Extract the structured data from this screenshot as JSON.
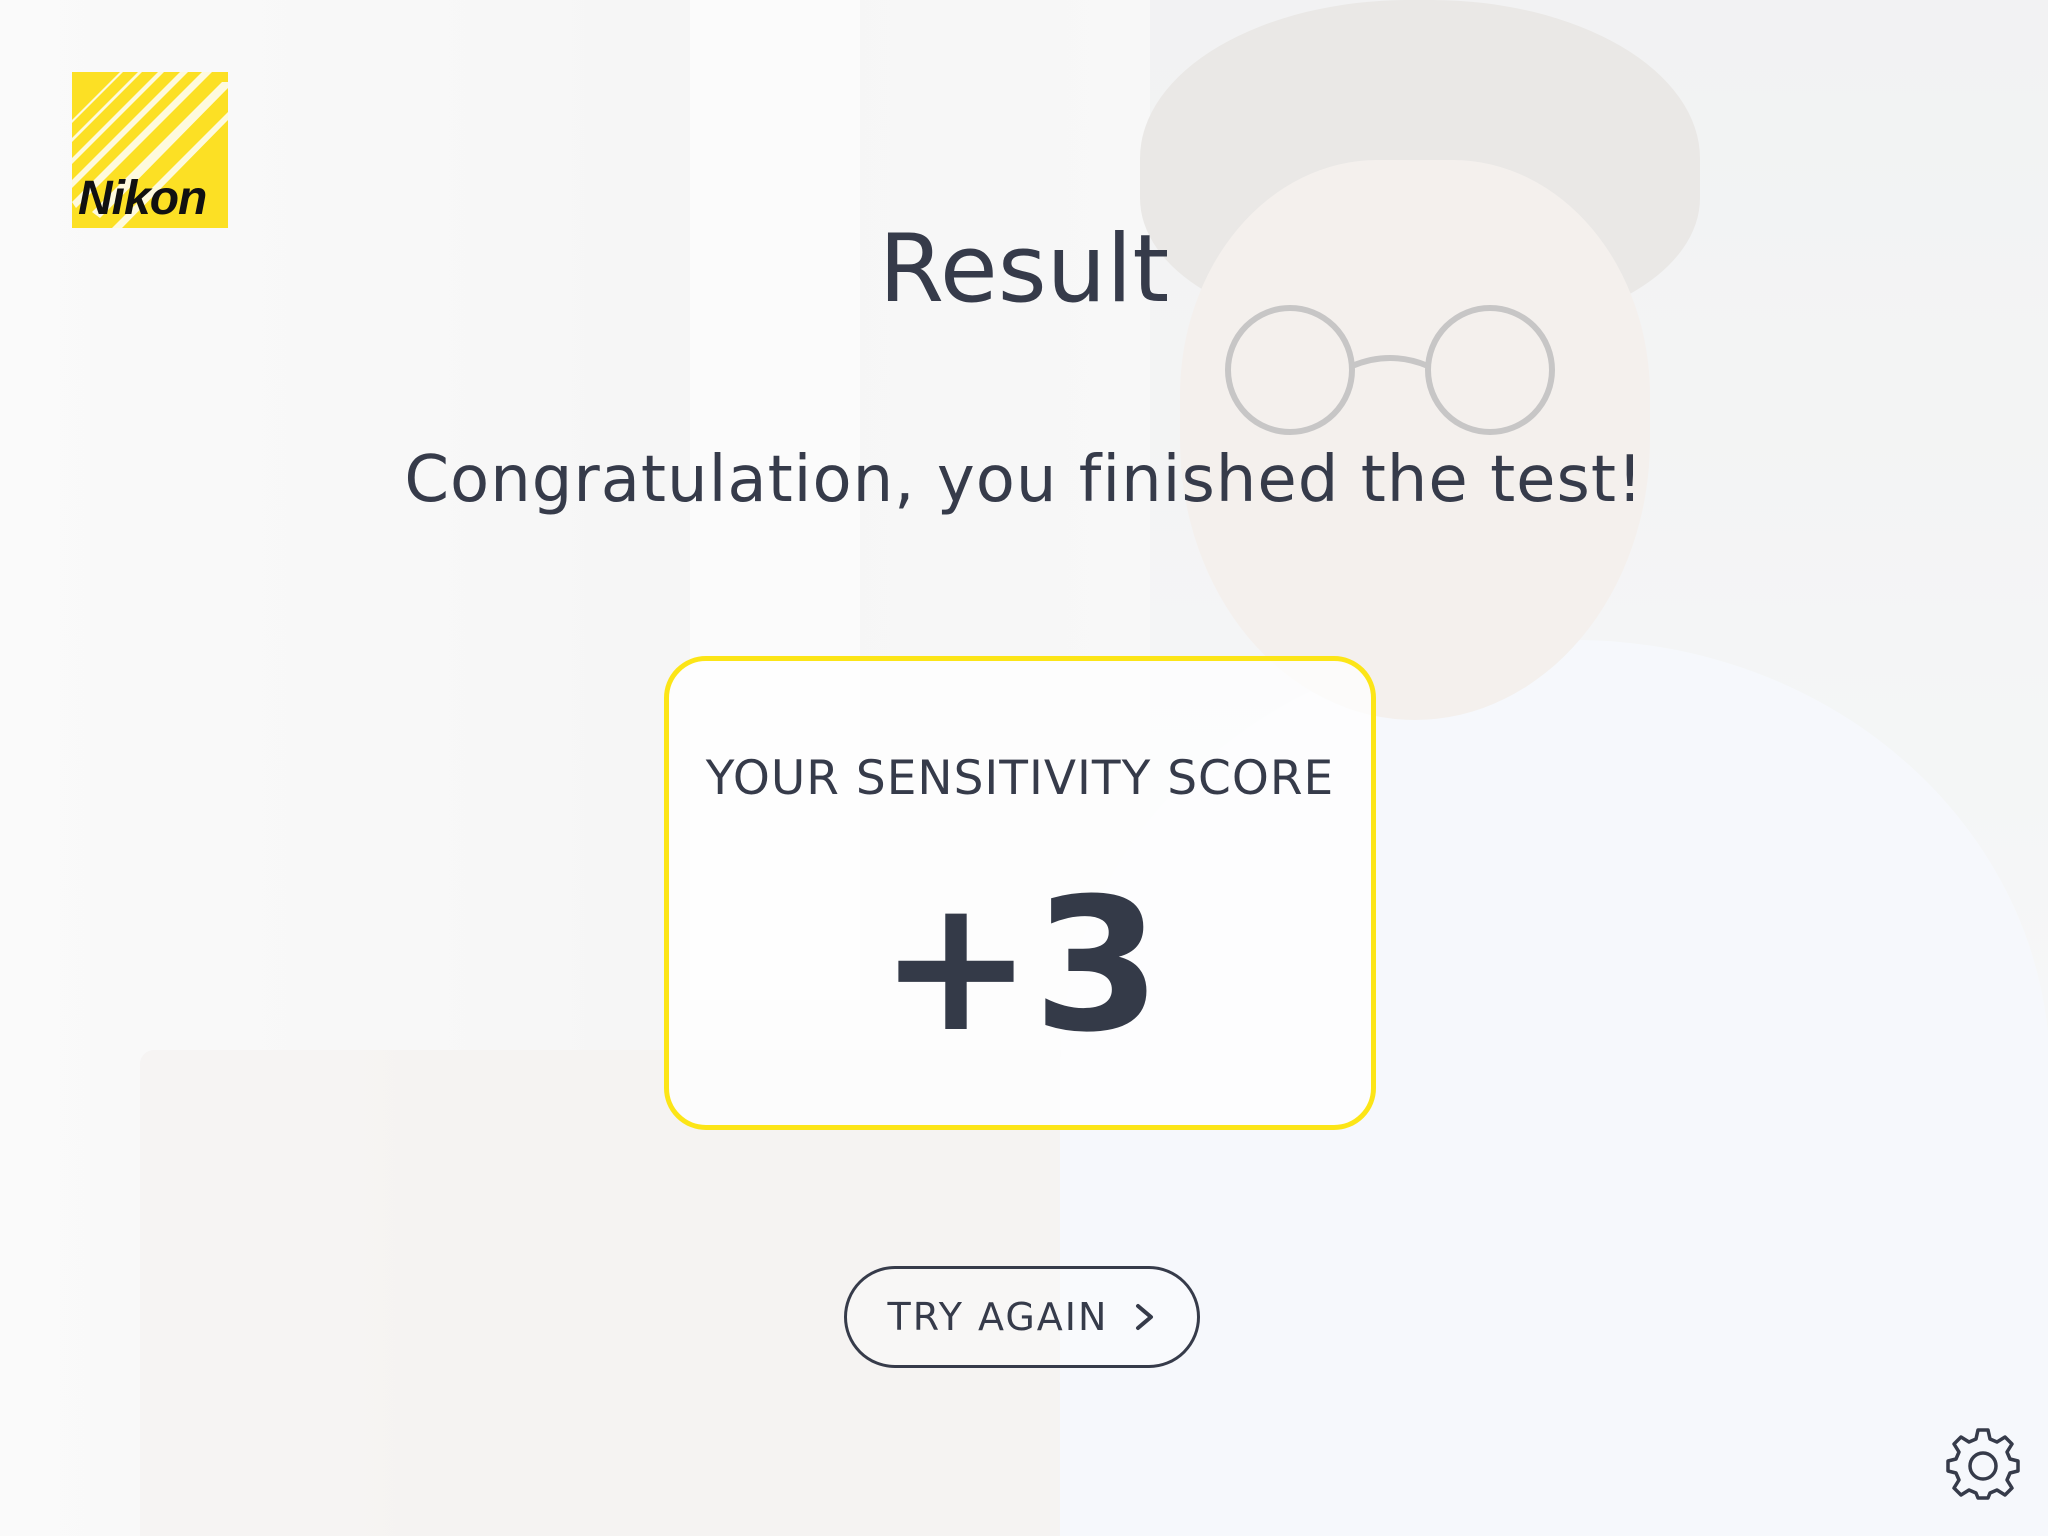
{
  "brand": {
    "logo_text": "Nikon",
    "logo_color": "#fce024",
    "logo_icon": "nikon-logo-icon"
  },
  "result": {
    "title": "Result",
    "message": "Congratulation, you finished the test!"
  },
  "score": {
    "label": "YOUR SENSITIVITY SCORE",
    "value": "+3",
    "card_border_color": "#fce517"
  },
  "actions": {
    "try_again_label": "TRY AGAIN",
    "try_again_icon": "chevron-right-icon",
    "settings_icon": "gear-icon"
  },
  "colors": {
    "text": "#363b4a",
    "accent": "#fce024"
  }
}
